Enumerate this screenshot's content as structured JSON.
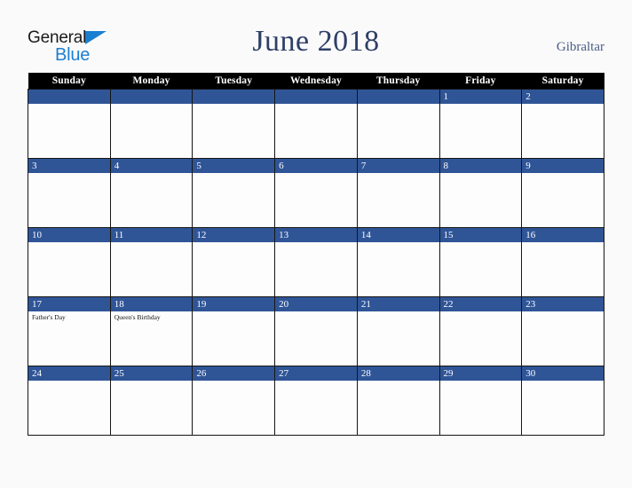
{
  "brand": {
    "line1": "General",
    "line2": "Blue",
    "triangle_icon": "brand-triangle-icon"
  },
  "header": {
    "title": "June 2018",
    "country": "Gibraltar"
  },
  "colors": {
    "page_background": "#fbfafb",
    "weekday_header_background": "#000000",
    "weekday_header_text": "#ffffff",
    "date_band": "#2f5597",
    "date_text": "#ffffff",
    "cell_background": "#fdfdfd",
    "cell_border": "#151515",
    "title_text": "#2e3f67",
    "country_text": "#4a5e85",
    "brand_blue": "#1b7fd0",
    "brand_dark": "#1a1a1a",
    "event_text": "#111111"
  },
  "calendar": {
    "weekdays": [
      "Sunday",
      "Monday",
      "Tuesday",
      "Wednesday",
      "Thursday",
      "Friday",
      "Saturday"
    ],
    "weeks": [
      [
        {
          "day": "",
          "events": []
        },
        {
          "day": "",
          "events": []
        },
        {
          "day": "",
          "events": []
        },
        {
          "day": "",
          "events": []
        },
        {
          "day": "",
          "events": []
        },
        {
          "day": "1",
          "events": []
        },
        {
          "day": "2",
          "events": []
        }
      ],
      [
        {
          "day": "3",
          "events": []
        },
        {
          "day": "4",
          "events": []
        },
        {
          "day": "5",
          "events": []
        },
        {
          "day": "6",
          "events": []
        },
        {
          "day": "7",
          "events": []
        },
        {
          "day": "8",
          "events": []
        },
        {
          "day": "9",
          "events": []
        }
      ],
      [
        {
          "day": "10",
          "events": []
        },
        {
          "day": "11",
          "events": []
        },
        {
          "day": "12",
          "events": []
        },
        {
          "day": "13",
          "events": []
        },
        {
          "day": "14",
          "events": []
        },
        {
          "day": "15",
          "events": []
        },
        {
          "day": "16",
          "events": []
        }
      ],
      [
        {
          "day": "17",
          "events": [
            "Father's Day"
          ]
        },
        {
          "day": "18",
          "events": [
            "Queen's Birthday"
          ]
        },
        {
          "day": "19",
          "events": []
        },
        {
          "day": "20",
          "events": []
        },
        {
          "day": "21",
          "events": []
        },
        {
          "day": "22",
          "events": []
        },
        {
          "day": "23",
          "events": []
        }
      ],
      [
        {
          "day": "24",
          "events": []
        },
        {
          "day": "25",
          "events": []
        },
        {
          "day": "26",
          "events": []
        },
        {
          "day": "27",
          "events": []
        },
        {
          "day": "28",
          "events": []
        },
        {
          "day": "29",
          "events": []
        },
        {
          "day": "30",
          "events": []
        }
      ]
    ]
  }
}
